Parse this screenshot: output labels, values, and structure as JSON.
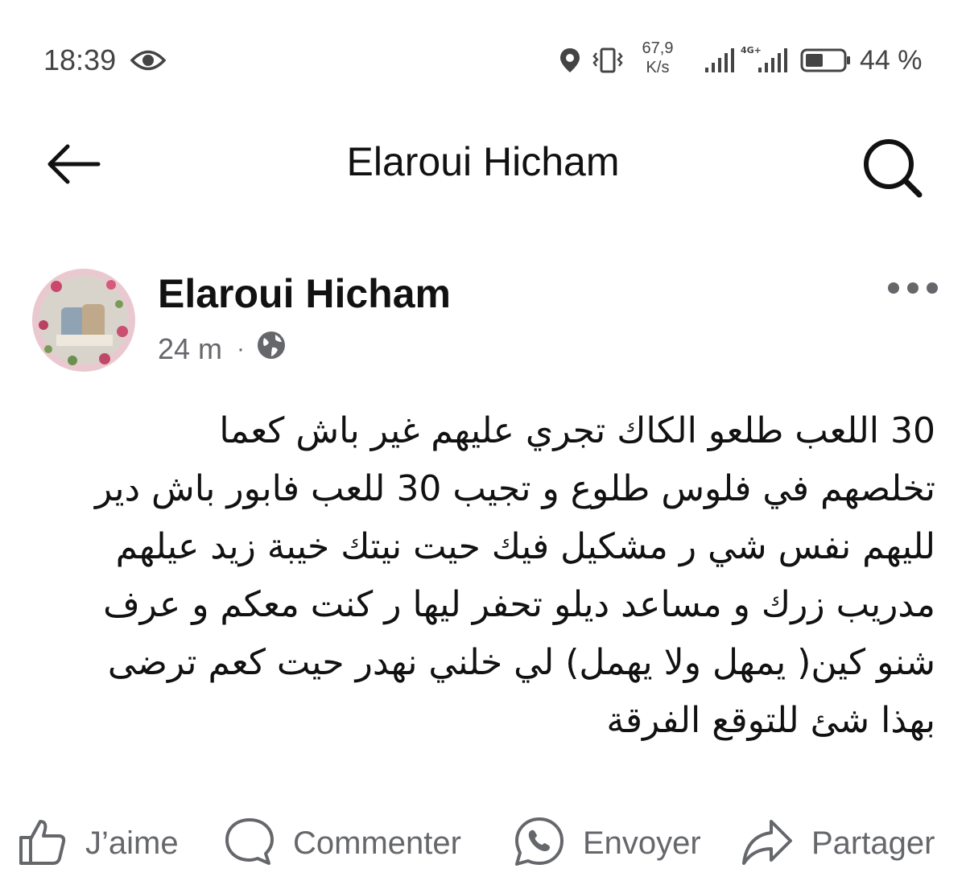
{
  "status_bar": {
    "time": "18:39",
    "speed_value": "67,9",
    "speed_unit": "K/s",
    "network": "4G+",
    "battery_percent": "44 %",
    "icons": [
      "eye-icon",
      "location-icon",
      "vibrate-icon",
      "signal-icon",
      "signal-4g-icon",
      "battery-icon"
    ]
  },
  "header": {
    "title": "Elaroui Hicham",
    "back_icon": "back-arrow-icon",
    "search_icon": "search-icon"
  },
  "post": {
    "author": "Elaroui Hicham",
    "time_ago": "24 m",
    "separator": "·",
    "privacy_icon": "globe-icon",
    "more_icon": "more-icon",
    "body_lines": [
      "30 اللعب طلعو الكاك  تجري عليهم غير باش كعما",
      "تخلصهم في فلوس طلوع و تجيب 30 للعب فابور باش دير",
      "لليهم نفس شي ر مشكيل فيك حيت نيتك خيبة زيد عيلهم",
      "مدريب زرك و مساعد ديلو تحفر ليها ر كنت معكم و عرف",
      "شنو كين( يمهل ولا يهمل) لي خلني نهدر حيت كعم ترضى",
      "بهذا شئ للتوقع الفرقة"
    ]
  },
  "actions": {
    "like_label": "J’aime",
    "comment_label": "Commenter",
    "send_label": "Envoyer",
    "share_label": "Partager"
  },
  "colors": {
    "text": "#111111",
    "muted": "#65676b",
    "background": "#ffffff"
  }
}
